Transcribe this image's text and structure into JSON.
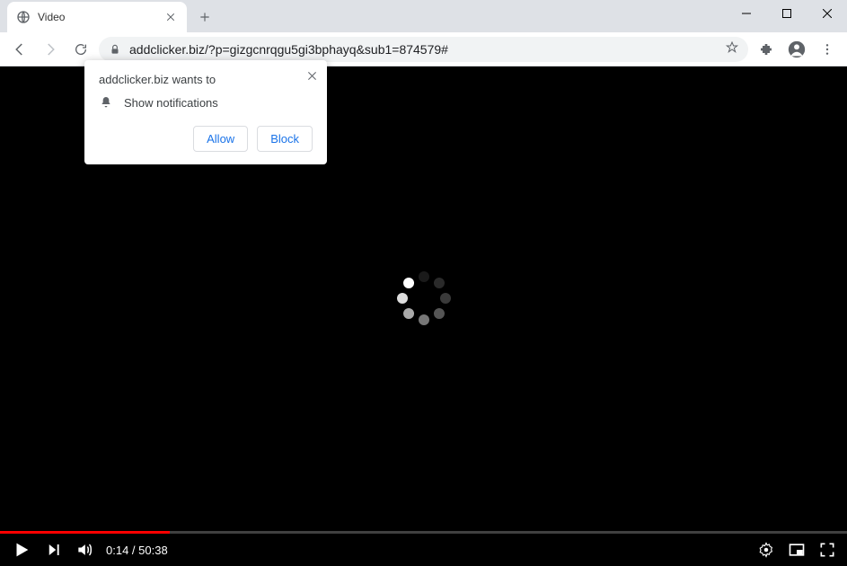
{
  "tab": {
    "title": "Video"
  },
  "toolbar": {
    "url": "addclicker.biz/?p=gizgcnrqgu5gi3bphayq&sub1=874579#"
  },
  "prompt": {
    "heading": "addclicker.biz wants to",
    "permission": "Show notifications",
    "allow": "Allow",
    "block": "Block"
  },
  "player": {
    "time_current": "0:14",
    "time_total": "50:38",
    "time_sep": " / ",
    "progress_percent": 20
  }
}
